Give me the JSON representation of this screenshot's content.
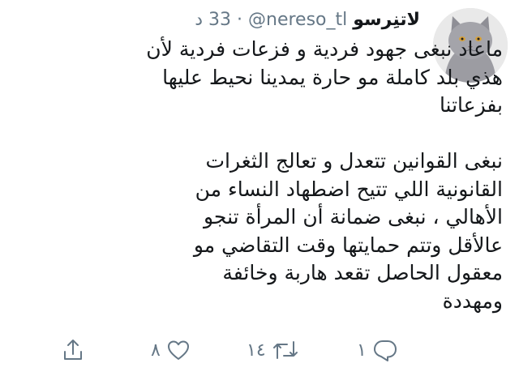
{
  "tweet": {
    "display_name": "لاتنِرسو",
    "handle": "@nereso_tl",
    "separator": "·",
    "time": "33 د",
    "paragraph1": [
      "ماعاد نبغى جهود فردية و فزعات فردية لأن",
      "هذي بلد كاملة مو حارة يمدينا نحيط عليها",
      "بفزعاتنا"
    ],
    "paragraph2": [
      "نبغى القوانين تتعدل و تعالج الثغرات",
      "القانونية اللي تتيح اضطهاد النساء من",
      "الأهالي ، نبغى ضمانة أن المرأة تنجو",
      "عالأقل وتتم حمايتها وقت التقاضي مو",
      "معقول الحاصل تقعد هاربة وخائفة",
      "ومهددة"
    ]
  },
  "actions": {
    "reply_count": "١",
    "retweet_count": "١٤",
    "like_count": "٨"
  },
  "icons": [
    "avatar-cat",
    "share-icon",
    "like-icon",
    "retweet-icon",
    "reply-icon"
  ],
  "colors": {
    "text": "#14171a",
    "muted": "#657786"
  }
}
